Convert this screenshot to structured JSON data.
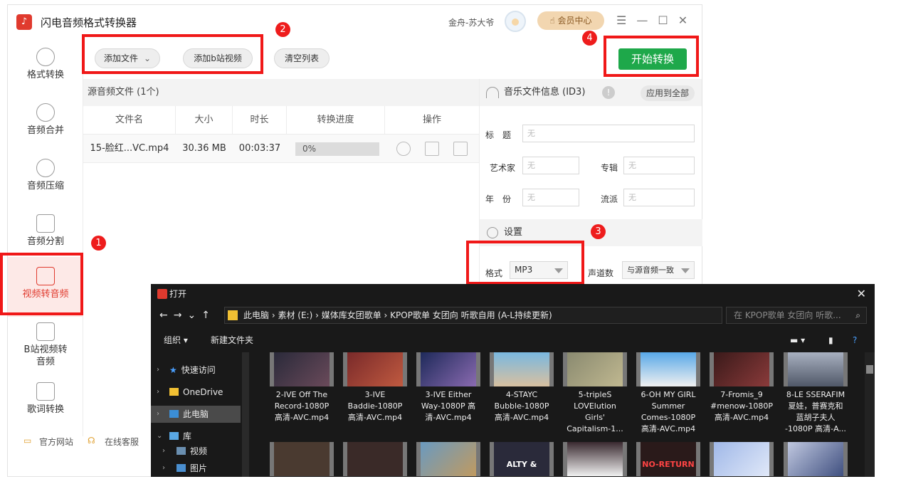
{
  "app": {
    "title": "闪电音频格式转换器",
    "user_name": "金舟-苏大爷",
    "vip_label": "会员中心",
    "accent": "#e03a2e",
    "green": "#1ea84a"
  },
  "sidebar": {
    "items": [
      {
        "label": "格式转换"
      },
      {
        "label": "音频合并"
      },
      {
        "label": "音频压缩"
      },
      {
        "label": "音频分割"
      },
      {
        "label": "视频转音频"
      },
      {
        "label": "B站视频转"
      },
      {
        "label": "音频"
      },
      {
        "label": "歌词转换"
      }
    ],
    "footer_website": "官方网站",
    "footer_service": "在线客服"
  },
  "toolbar": {
    "add_file": "添加文件",
    "add_bilibili": "添加b站视频",
    "clear_list": "清空列表",
    "start": "开始转换"
  },
  "file_list": {
    "header": "源音频文件 (1个)",
    "columns": [
      "文件名",
      "大小",
      "时长",
      "转换进度",
      "操作"
    ],
    "rows": [
      {
        "name": "15-脸红...VC.mp4",
        "size": "30.36 MB",
        "duration": "00:03:37",
        "progress": 0,
        "progress_text": "0%"
      }
    ]
  },
  "id3": {
    "header": "音乐文件信息 (ID3)",
    "apply_all": "应用到全部",
    "title_label": "标　题",
    "artist_label": "艺术家",
    "album_label": "专辑",
    "year_label": "年　份",
    "genre_label": "流派",
    "placeholder": "无"
  },
  "settings": {
    "header": "设置",
    "format_label": "格式",
    "format_value": "MP3",
    "channel_label": "声道数",
    "channel_value": "与源音频一致"
  },
  "annotations": [
    "1",
    "2",
    "3",
    "4"
  ],
  "dialog": {
    "title": "打开",
    "breadcrumb": [
      "此电脑",
      "素材 (E:)",
      "媒体库女团歌单",
      "KPOP歌单 女团向 听歌自用 (A-L持续更新)"
    ],
    "search_placeholder": "在 KPOP歌单 女团向 听歌...",
    "organize": "组织 ▾",
    "new_folder": "新建文件夹",
    "nav": [
      {
        "label": "快速访问"
      },
      {
        "label": "OneDrive"
      },
      {
        "label": "此电脑"
      },
      {
        "label": "库"
      },
      {
        "label": "视频"
      },
      {
        "label": "图片"
      }
    ],
    "files": [
      [
        "2-IVE Off The",
        "Record-1080P",
        "高清-AVC.mp4"
      ],
      [
        "3-IVE",
        "Baddie-1080P",
        "高清-AVC.mp4"
      ],
      [
        "3-IVE Either",
        "Way-1080P 高",
        "清-AVC.mp4"
      ],
      [
        "4-STAYC",
        "Bubble-1080P",
        "高清-AVC.mp4"
      ],
      [
        "5-tripleS",
        "LOVElution",
        "Girls'",
        "Capitalism-1..."
      ],
      [
        "6-OH MY GIRL",
        "Summer",
        "Comes-1080P",
        "高清-AVC.mp4"
      ],
      [
        "7-Fromis_9",
        "#menow-1080P",
        "高清-AVC.mp4"
      ],
      [
        "8-LE SSERAFIM",
        "夏娃，普赛克和",
        "蓝胡子夫人",
        "-1080P 高清-A..."
      ]
    ],
    "thumb_text_1": "ALTY & SWEE",
    "thumb_text_2": "NO-RETURN"
  }
}
